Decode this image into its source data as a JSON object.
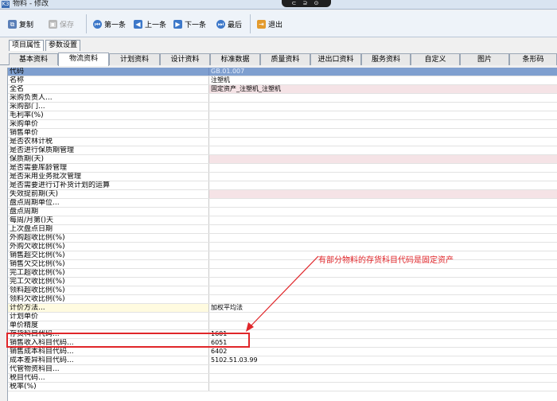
{
  "window": {
    "title": "物料 - 修改",
    "app_badge": "K3",
    "window_controls": "⊂ ⊇ ⊙"
  },
  "toolbar": {
    "copy": "复制",
    "save": "保存",
    "first": "第一条",
    "prev": "上一条",
    "next": "下一条",
    "last": "最后",
    "exit": "退出"
  },
  "subtabs": [
    "项目属性",
    "参数设置"
  ],
  "tabs": [
    "基本资料",
    "物流资料",
    "计划资料",
    "设计资料",
    "标准数据",
    "质量资料",
    "进出口资料",
    "服务资料",
    "自定义",
    "图片",
    "条形码"
  ],
  "active_tab": "物流资料",
  "rows": [
    {
      "label": "代码",
      "value": "GB.01.007",
      "style": "header"
    },
    {
      "label": "名称",
      "value": "注塑机",
      "style": ""
    },
    {
      "label": "全名",
      "value": "固定资产_注塑机_注塑机",
      "style": "pink"
    },
    {
      "label": "采购负责人...",
      "value": "",
      "style": ""
    },
    {
      "label": "采购部门...",
      "value": "",
      "style": ""
    },
    {
      "label": "毛利率(%)",
      "value": "",
      "style": ""
    },
    {
      "label": "采购单价",
      "value": "",
      "style": ""
    },
    {
      "label": "销售单价",
      "value": "",
      "style": ""
    },
    {
      "label": "是否农林计税",
      "value": "",
      "style": "",
      "check": ""
    },
    {
      "label": "是否进行保质期管理",
      "value": "",
      "style": "",
      "check": ""
    },
    {
      "label": "保质期(天)",
      "value": "",
      "style": "pink"
    },
    {
      "label": "是否需要库龄管理",
      "value": "",
      "style": "",
      "check": ""
    },
    {
      "label": "是否采用业务批次管理",
      "value": "",
      "style": "",
      "check": "✓"
    },
    {
      "label": "是否需要进行订补货计划的运算",
      "value": "",
      "style": "",
      "check": ""
    },
    {
      "label": "失效提前期(天)",
      "value": "",
      "style": "pink"
    },
    {
      "label": "盘点周期单位...",
      "value": "",
      "style": ""
    },
    {
      "label": "盘点周期",
      "value": "",
      "style": ""
    },
    {
      "label": "每周/月第()天",
      "value": "",
      "style": ""
    },
    {
      "label": "上次盘点日期",
      "value": "",
      "style": ""
    },
    {
      "label": "外购超收比例(%)",
      "value": "",
      "style": ""
    },
    {
      "label": "外购欠收比例(%)",
      "value": "",
      "style": ""
    },
    {
      "label": "销售超交比例(%)",
      "value": "",
      "style": ""
    },
    {
      "label": "销售欠交比例(%)",
      "value": "",
      "style": ""
    },
    {
      "label": "完工超收比例(%)",
      "value": "",
      "style": ""
    },
    {
      "label": "完工欠收比例(%)",
      "value": "",
      "style": ""
    },
    {
      "label": "领料超收比例(%)",
      "value": "",
      "style": ""
    },
    {
      "label": "领料欠收比例(%)",
      "value": "",
      "style": ""
    },
    {
      "label": "计价方法...",
      "value": "加权平均法",
      "style": "yellow"
    },
    {
      "label": "计划单价",
      "value": "",
      "style": ""
    },
    {
      "label": "单价精度",
      "value": "",
      "style": ""
    },
    {
      "label": "存货科目代码...",
      "value": "1601",
      "style": ""
    },
    {
      "label": "销售收入科目代码...",
      "value": "6051",
      "style": ""
    },
    {
      "label": "销售成本科目代码...",
      "value": "6402",
      "style": ""
    },
    {
      "label": "成本差异科目代码...",
      "value": "5102.51.03.99",
      "style": ""
    },
    {
      "label": "代管物资科目...",
      "value": "",
      "style": ""
    },
    {
      "label": "税目代码...",
      "value": "",
      "style": ""
    },
    {
      "label": "税率(%)",
      "value": "",
      "style": ""
    }
  ],
  "annotation": {
    "text": "有部分物料的存货科目代码是固定资产",
    "color": "#e0262a"
  }
}
